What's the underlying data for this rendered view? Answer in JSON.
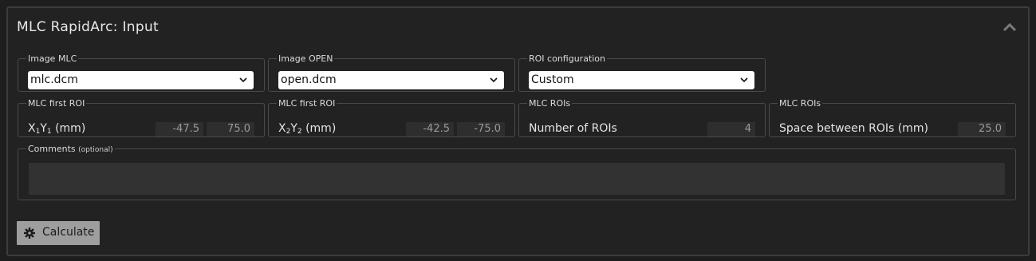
{
  "panel": {
    "title": "MLC RapidArc: Input"
  },
  "image_mlc": {
    "legend": "Image MLC",
    "value": "mlc.dcm"
  },
  "image_open": {
    "legend": "Image OPEN",
    "value": "open.dcm"
  },
  "roi_config": {
    "legend": "ROI configuration",
    "value": "Custom"
  },
  "first_roi_1": {
    "legend": "MLC first ROI",
    "label_base": "X",
    "sub1": "1",
    "mid": "Y",
    "sub2": "1",
    "unit": " (mm)",
    "x": "-47.5",
    "y": "75.0"
  },
  "first_roi_2": {
    "legend": "MLC first ROI",
    "label_base": "X",
    "sub1": "2",
    "mid": "Y",
    "sub2": "2",
    "unit": " (mm)",
    "x": "-42.5",
    "y": "-75.0"
  },
  "roi_count": {
    "legend": "MLC ROIs",
    "label": "Number of ROIs",
    "value": "4"
  },
  "roi_space": {
    "legend": "MLC ROIs",
    "label": "Space between ROIs (mm)",
    "value": "25.0"
  },
  "comments": {
    "legend": "Comments",
    "legend_note": "(optional)",
    "value": ""
  },
  "calculate": {
    "label": "Calculate"
  }
}
